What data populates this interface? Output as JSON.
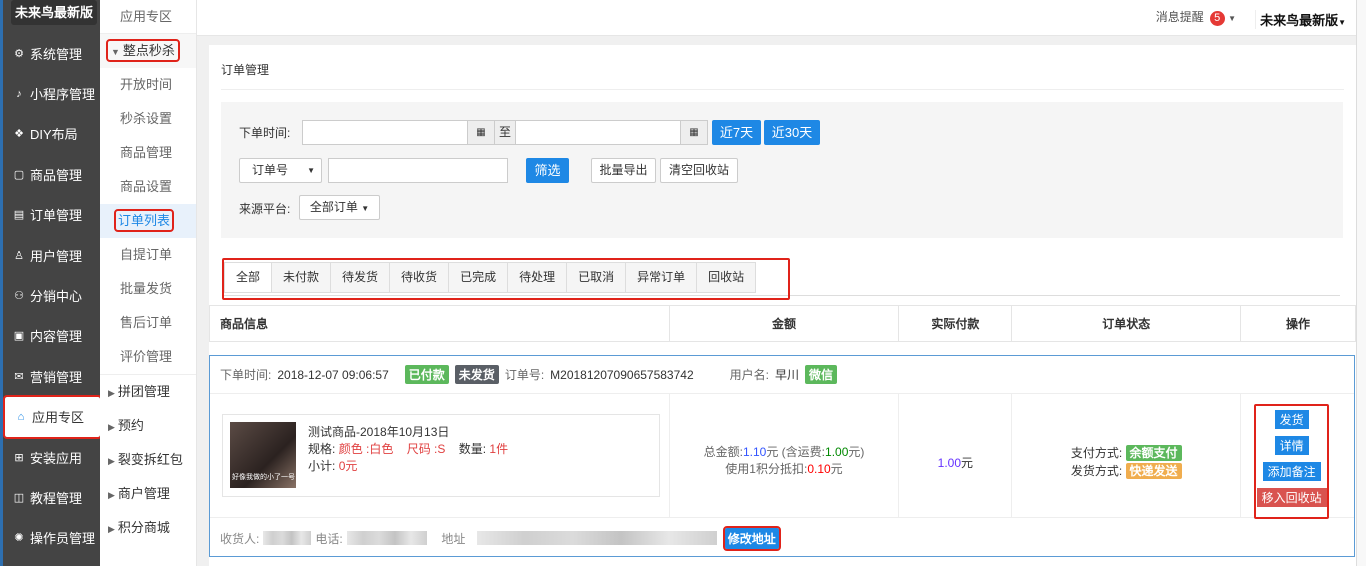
{
  "sidebar": {
    "brand": "未来鸟最新版",
    "items": [
      {
        "label": "系统管理",
        "icon": "⚙"
      },
      {
        "label": "小程序管理",
        "icon": "♪"
      },
      {
        "label": "DIY布局",
        "icon": "❖"
      },
      {
        "label": "商品管理",
        "icon": "▢"
      },
      {
        "label": "订单管理",
        "icon": "▤"
      },
      {
        "label": "用户管理",
        "icon": "♙"
      },
      {
        "label": "分销中心",
        "icon": "⚇"
      },
      {
        "label": "内容管理",
        "icon": "▣"
      },
      {
        "label": "营销管理",
        "icon": "✉"
      },
      {
        "label": "应用专区",
        "icon": "⌂"
      },
      {
        "label": "安装应用",
        "icon": "⊞"
      },
      {
        "label": "教程管理",
        "icon": "◫"
      },
      {
        "label": "操作员管理",
        "icon": "✺"
      }
    ]
  },
  "subnav": {
    "title": "应用专区",
    "group": "整点秒杀",
    "items": [
      "开放时间",
      "秒杀设置",
      "商品管理",
      "商品设置",
      "订单列表",
      "自提订单",
      "批量发货",
      "售后订单",
      "评价管理"
    ],
    "collapsed": [
      "拼团管理",
      "预约",
      "裂变拆红包",
      "商户管理",
      "积分商城"
    ]
  },
  "topbar": {
    "messages": "消息提醒",
    "count": "5",
    "user": "未来鸟最新版"
  },
  "page": {
    "title": "订单管理"
  },
  "filter": {
    "time_label": "下单时间:",
    "to": "至",
    "btn7": "近7天",
    "btn30": "近30天",
    "select": "订单号",
    "search": "筛选",
    "export": "批量导出",
    "clear": "清空回收站",
    "source_label": "来源平台:",
    "source": "全部订单"
  },
  "tabs": [
    "全部",
    "未付款",
    "待发货",
    "待收货",
    "已完成",
    "待处理",
    "已取消",
    "异常订单",
    "回收站"
  ],
  "columns": [
    "商品信息",
    "金额",
    "实际付款",
    "订单状态",
    "操作"
  ],
  "order": {
    "time_label": "下单时间:",
    "time": "2018-12-07 09:06:57",
    "paid": "已付款",
    "unshipped": "未发货",
    "no_label": "订单号:",
    "no": "M20181207090657583742",
    "user_label": "用户名:",
    "user": "早川",
    "channel": "微信",
    "product": {
      "name": "测试商品-2018年10月13日",
      "spec_label": "规格:",
      "color": "颜色 :白色",
      "size": "尺码 :S",
      "qty_label": "数量:",
      "qty": "1件",
      "sub_label": "小计:",
      "sub": "0元",
      "caption": "好像我做的小了一号"
    },
    "total_label": "总金额:",
    "total": "1.10",
    "yuan": "元",
    "freight_label": "(含运费:",
    "freight": "1.00",
    "freight_end": "元)",
    "points_label": "使用1积分抵扣:",
    "points": "0.10",
    "actual": "1.00",
    "pay_label": "支付方式:",
    "pay": "余额支付",
    "ship_label": "发货方式:",
    "ship": "快递发送",
    "ops": [
      "发货",
      "详情",
      "添加备注",
      "移入回收站"
    ],
    "receiver_label": "收货人:",
    "phone_label": "电话:",
    "addr_label": "地址",
    "edit_addr": "修改地址"
  }
}
